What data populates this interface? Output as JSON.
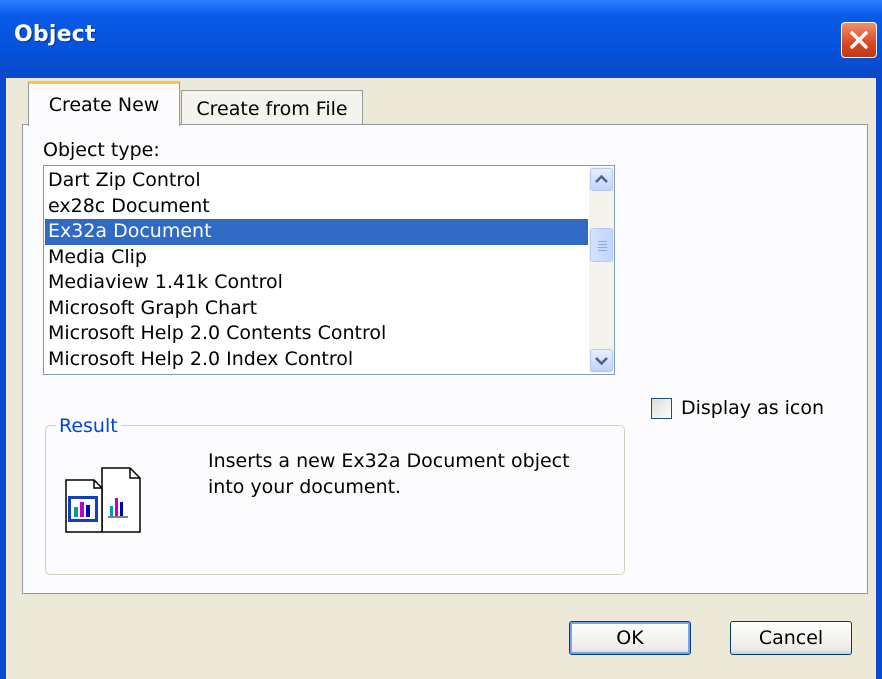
{
  "window": {
    "title": "Object"
  },
  "tabs": [
    {
      "label": "Create New",
      "active": true
    },
    {
      "label": "Create from File",
      "active": false
    }
  ],
  "object_type": {
    "label": "Object type:",
    "items": [
      "Dart Zip Control",
      "ex28c Document",
      "Ex32a Document",
      "Media Clip",
      "Mediaview 1.41k Control",
      "Microsoft Graph Chart",
      "Microsoft Help 2.0 Contents Control",
      "Microsoft Help 2.0 Index Control"
    ],
    "selected": "Ex32a Document"
  },
  "display_as_icon": {
    "label": "Display as icon",
    "checked": false
  },
  "result": {
    "legend": "Result",
    "text": "Inserts a new Ex32a Document object into your document."
  },
  "buttons": {
    "ok": "OK",
    "cancel": "Cancel"
  },
  "colors": {
    "titlebar": "#0553dd",
    "selection": "#316ac5",
    "dialog_face": "#ece9d8",
    "group_legend": "#0046d5"
  }
}
